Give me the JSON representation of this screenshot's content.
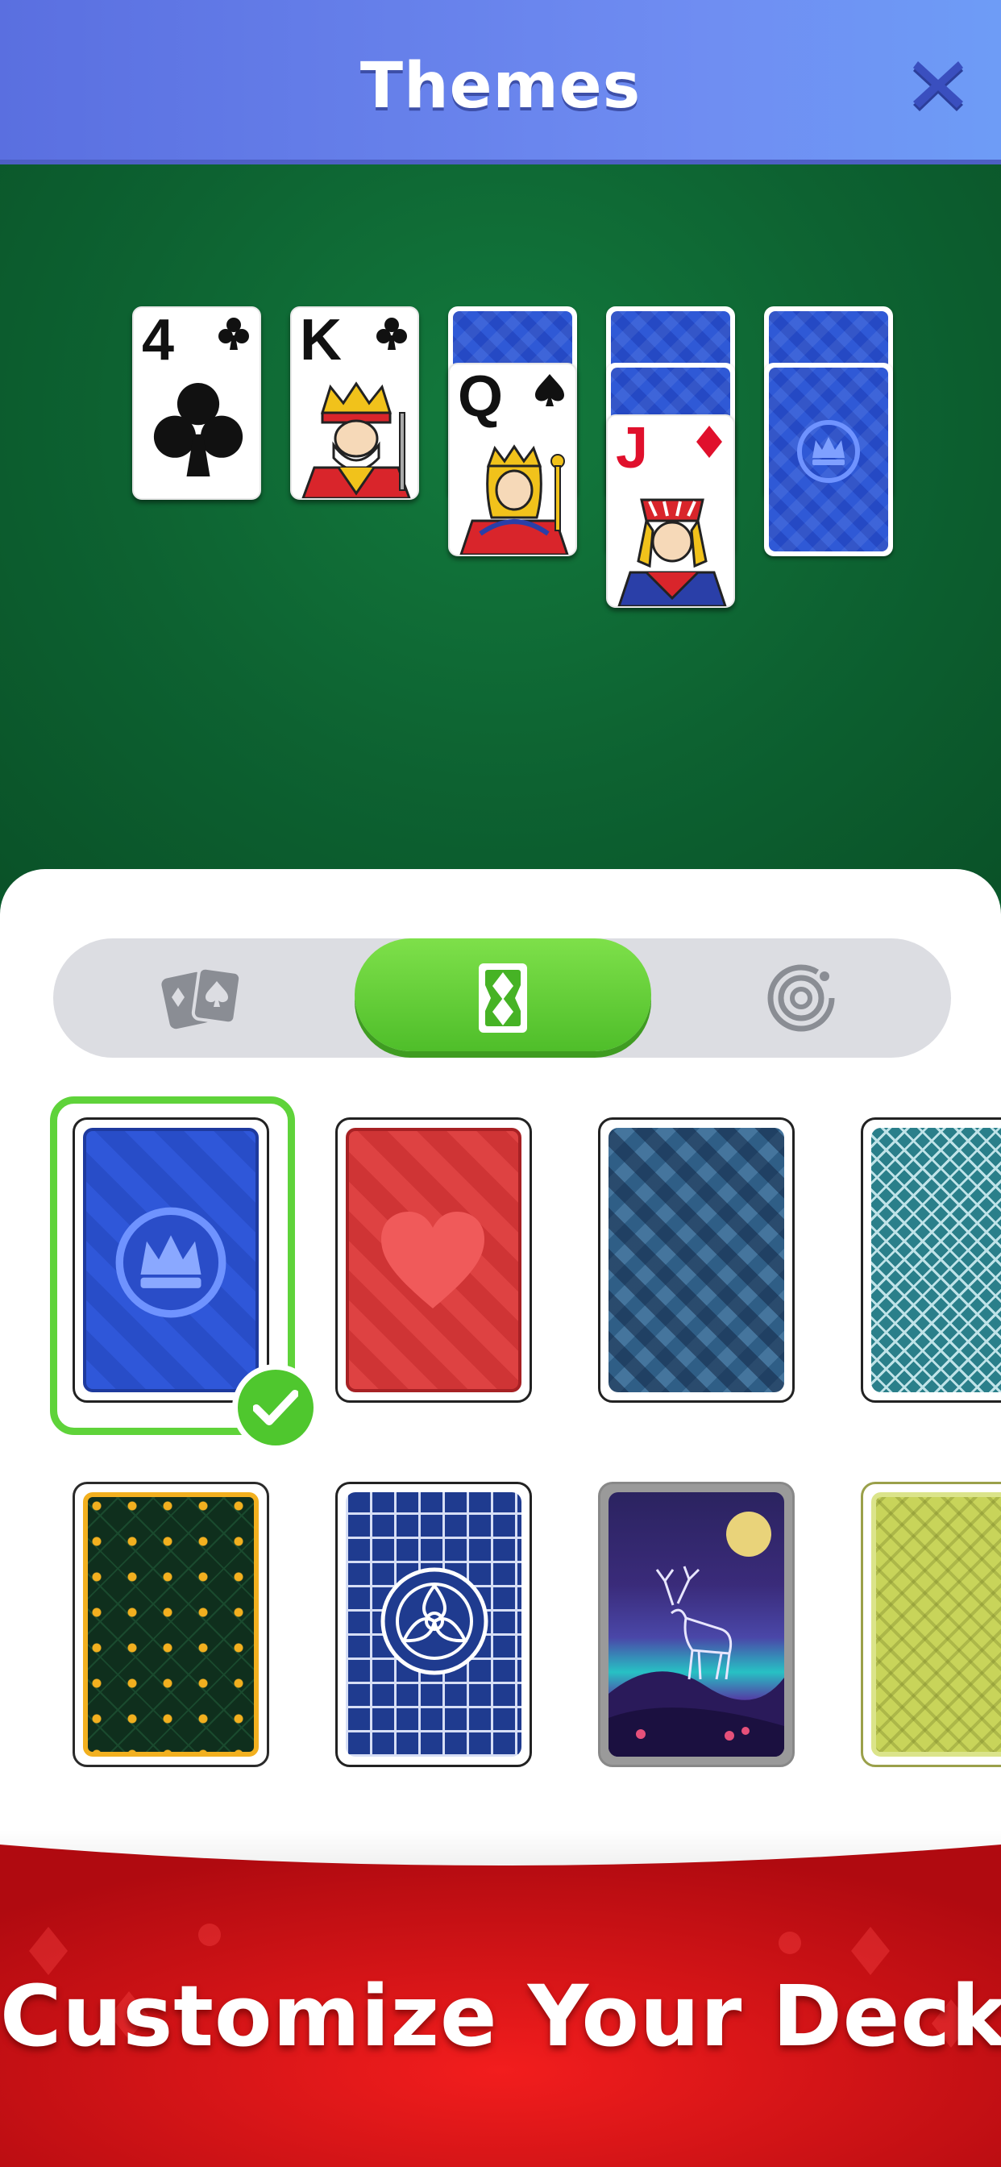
{
  "header": {
    "title": "Themes",
    "close_icon": "close-icon"
  },
  "tableau": {
    "cards": [
      {
        "rank": "4",
        "suit": "clubs",
        "color": "black"
      },
      {
        "rank": "K",
        "suit": "clubs",
        "color": "black"
      },
      {
        "rank": "Q",
        "suit": "spades",
        "color": "black"
      },
      {
        "rank": "J",
        "suit": "diamonds",
        "color": "red"
      },
      {
        "rank": "",
        "suit": "",
        "face_down": true
      }
    ]
  },
  "tabs": [
    {
      "name": "cards-tab",
      "icon": "playing-cards-icon",
      "active": false
    },
    {
      "name": "card-backs-tab",
      "icon": "card-back-icon",
      "active": true
    },
    {
      "name": "background-tab",
      "icon": "target-rings-icon",
      "active": false
    }
  ],
  "card_backs": [
    {
      "name": "blue-crown",
      "border": "#ffffff",
      "primary": "#2b4fd0",
      "selected": true
    },
    {
      "name": "red-heart",
      "border": "#ffffff",
      "primary": "#d9393a",
      "selected": false
    },
    {
      "name": "blue-diamond",
      "border": "#ffffff",
      "primary": "#2f5e86",
      "selected": false
    },
    {
      "name": "teal-lattice",
      "border": "#ffffff",
      "primary": "#2a7f8a",
      "selected": false
    },
    {
      "name": "green-gold-hearts",
      "border": "#f2b01f",
      "primary": "#0f3b22",
      "selected": false
    },
    {
      "name": "navy-lattice-circle",
      "border": "#ffffff",
      "primary": "#1f3b8f",
      "selected": false
    },
    {
      "name": "night-deer",
      "border": "#8a8a8a",
      "primary": "#3a2a7a",
      "selected": false
    },
    {
      "name": "olive-ornate",
      "border": "#c8d27a",
      "primary": "#c8d45a",
      "selected": false
    }
  ],
  "banner": {
    "text": "Customize Your Deck"
  },
  "colors": {
    "accent_green": "#5fd33a",
    "header_blue": "#6a84ee",
    "felt_green": "#0d6231",
    "banner_red": "#e3161b"
  }
}
